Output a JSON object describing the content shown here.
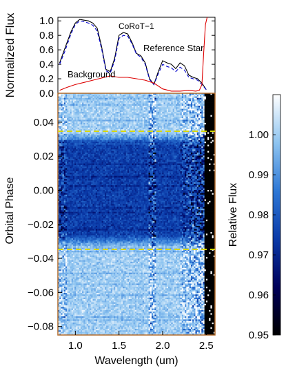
{
  "chart_data": [
    {
      "type": "line",
      "ylabel": "Normalized Flux",
      "ylim": [
        0.0,
        1.05
      ],
      "yticks": [
        "0.0",
        "0.2",
        "0.4",
        "0.6",
        "0.8",
        "1.0"
      ],
      "xlim": [
        0.8,
        2.6
      ],
      "series": [
        {
          "name": "CoRoT−1",
          "color": "#000000",
          "style": "solid",
          "x": [
            0.82,
            0.88,
            0.95,
            1.0,
            1.05,
            1.1,
            1.15,
            1.2,
            1.25,
            1.3,
            1.35,
            1.4,
            1.45,
            1.5,
            1.55,
            1.6,
            1.65,
            1.7,
            1.75,
            1.8,
            1.85,
            1.9,
            1.95,
            2.0,
            2.05,
            2.1,
            2.15,
            2.2,
            2.25,
            2.3,
            2.35,
            2.4,
            2.45,
            2.5
          ],
          "y": [
            0.42,
            0.62,
            0.85,
            0.97,
            1.02,
            1.01,
            1.0,
            0.97,
            0.9,
            0.65,
            0.33,
            0.3,
            0.48,
            0.8,
            0.84,
            0.82,
            0.7,
            0.55,
            0.52,
            0.42,
            0.2,
            0.12,
            0.3,
            0.45,
            0.42,
            0.4,
            0.34,
            0.42,
            0.38,
            0.25,
            0.22,
            0.2,
            0.14,
            0.05
          ]
        },
        {
          "name": "Reference Star",
          "color": "#0000cc",
          "style": "dash",
          "x": [
            0.82,
            0.88,
            0.95,
            1.0,
            1.05,
            1.1,
            1.15,
            1.2,
            1.25,
            1.3,
            1.35,
            1.4,
            1.45,
            1.5,
            1.55,
            1.6,
            1.65,
            1.7,
            1.75,
            1.8,
            1.85,
            1.9,
            1.95,
            2.0,
            2.05,
            2.1,
            2.15,
            2.2,
            2.25,
            2.3,
            2.35,
            2.4,
            2.45,
            2.5
          ],
          "y": [
            0.4,
            0.58,
            0.82,
            0.95,
            1.0,
            0.99,
            0.97,
            0.94,
            0.86,
            0.62,
            0.31,
            0.28,
            0.45,
            0.76,
            0.8,
            0.79,
            0.68,
            0.54,
            0.5,
            0.4,
            0.19,
            0.12,
            0.27,
            0.4,
            0.37,
            0.35,
            0.3,
            0.36,
            0.32,
            0.22,
            0.2,
            0.18,
            0.12,
            0.05
          ]
        },
        {
          "name": "Background",
          "color": "#dd0000",
          "style": "solid",
          "x": [
            0.82,
            0.9,
            1.0,
            1.1,
            1.2,
            1.3,
            1.4,
            1.5,
            1.6,
            1.7,
            1.8,
            1.9,
            2.0,
            2.1,
            2.2,
            2.3,
            2.38,
            2.42,
            2.45,
            2.47,
            2.49,
            2.51
          ],
          "y": [
            0.04,
            0.08,
            0.12,
            0.15,
            0.18,
            0.21,
            0.24,
            0.22,
            0.22,
            0.2,
            0.18,
            0.14,
            0.06,
            0.03,
            0.03,
            0.04,
            0.03,
            0.04,
            0.12,
            0.55,
            0.95,
            1.2
          ]
        }
      ]
    },
    {
      "type": "heatmap",
      "xlabel": "Wavelength (um)",
      "ylabel": "Orbital Phase",
      "xlim": [
        0.8,
        2.6
      ],
      "ylim": [
        -0.085,
        0.057
      ],
      "xticks": [
        "1.0",
        "1.5",
        "2.0",
        "2.5"
      ],
      "yticks": [
        "0.04",
        "0.02",
        "0.00",
        "−0.02",
        "−0.04",
        "−0.06",
        "−0.08"
      ],
      "ingress_egress_phase": [
        0.034,
        -0.034
      ],
      "transit_depth_relative_flux": 0.975,
      "colorbar": {
        "label": "Relative Flux",
        "range": [
          0.95,
          1.01
        ],
        "ticks": [
          "1.00",
          "0.99",
          "0.98",
          "0.97",
          "0.96",
          "0.95"
        ],
        "colors": [
          "#000000",
          "#00005a",
          "#0a3aa8",
          "#2e78d6",
          "#8ec4f0",
          "#ffffff"
        ]
      }
    }
  ]
}
